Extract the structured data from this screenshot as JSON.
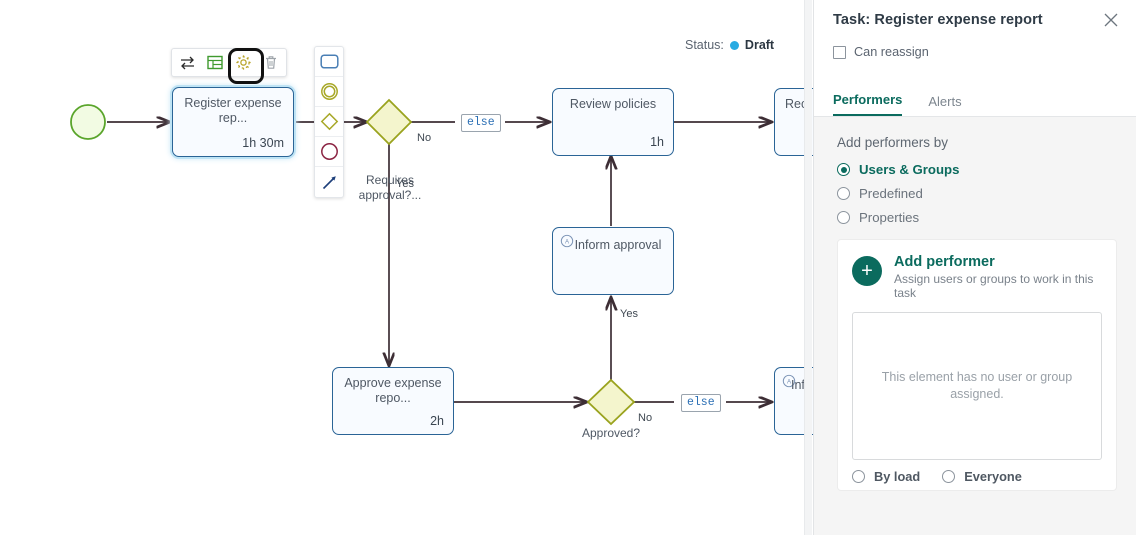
{
  "canvas": {
    "status": {
      "label": "Status:",
      "value": "Draft",
      "dot_color": "#29abe2"
    },
    "toolbar": {
      "swap_icon": "swap-arrows-icon",
      "form_icon": "form-table-icon",
      "settings_icon": "gear-icon",
      "delete_icon": "trash-icon"
    },
    "palette": [
      {
        "icon": "task-rectangle-icon",
        "label": "Task"
      },
      {
        "icon": "end-event-circle-icon",
        "label": "End event"
      },
      {
        "icon": "gateway-diamond-icon",
        "label": "Gateway"
      },
      {
        "icon": "event-circle-icon",
        "label": "Event"
      },
      {
        "icon": "connector-arrow-icon",
        "label": "Connector"
      }
    ],
    "nodes": [
      {
        "title": "Register expense rep...",
        "duration": "1h 30m"
      },
      {
        "title": "Review policies",
        "duration": "1h"
      },
      {
        "title": "Inform approval",
        "duration": ""
      },
      {
        "title": "Approve expense repo...",
        "duration": "2h"
      },
      {
        "title": "Rec",
        "duration": ""
      },
      {
        "title": "Info",
        "duration": ""
      }
    ],
    "gateways": [
      {
        "label": "Requires approval?..."
      },
      {
        "label": "Approved?"
      }
    ],
    "edge_labels": [
      {
        "text": "No"
      },
      {
        "text": "Yes"
      },
      {
        "text": "Yes"
      },
      {
        "text": "No"
      }
    ],
    "conditions": [
      {
        "text": "else"
      },
      {
        "text": "else"
      }
    ]
  },
  "panel": {
    "title": "Task: Register expense report",
    "close_icon": "close-icon",
    "can_reassign": {
      "label": "Can reassign",
      "checked": false
    },
    "tabs": [
      {
        "label": "Performers",
        "active": true
      },
      {
        "label": "Alerts",
        "active": false
      }
    ],
    "section_title": "Add performers by",
    "performer_modes": [
      {
        "label": "Users & Groups",
        "checked": true
      },
      {
        "label": "Predefined",
        "checked": false
      },
      {
        "label": "Properties",
        "checked": false
      }
    ],
    "add_performer": {
      "icon": "plus-icon",
      "title": "Add performer",
      "subtitle": "Assign users or groups to work in this task"
    },
    "empty_state": "This element has no user or group assigned.",
    "bottom_options": [
      {
        "label": "By load",
        "checked": false
      },
      {
        "label": "Everyone",
        "checked": false
      }
    ],
    "accent_color": "#0b6b5e"
  }
}
